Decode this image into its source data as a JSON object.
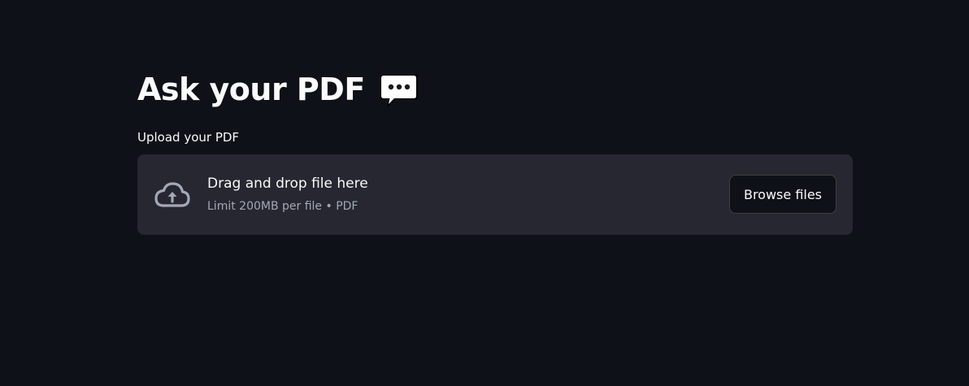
{
  "page": {
    "title": "Ask your PDF",
    "title_icon": "speech-balloon-icon"
  },
  "uploader": {
    "label": "Upload your PDF",
    "dropzone_title": "Drag and drop file here",
    "dropzone_limit": "Limit 200MB per file • PDF",
    "browse_label": "Browse files",
    "icon": "cloud-upload-icon"
  },
  "colors": {
    "background": "#0e1117",
    "dropzone": "#262730",
    "text": "#fafafa",
    "muted_text": "#a3a8b8"
  }
}
